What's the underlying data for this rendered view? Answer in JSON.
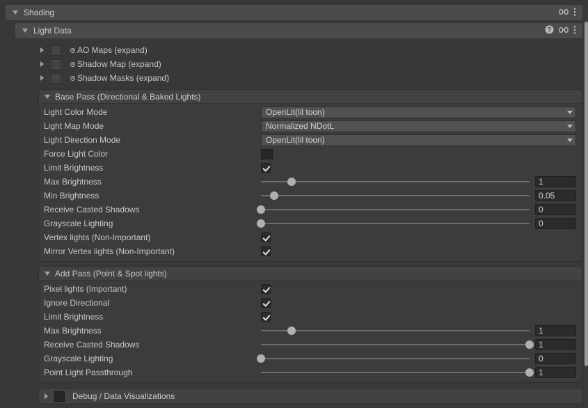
{
  "shading": {
    "title": "Shading",
    "icons": [
      "link-icon",
      "more-vertical-icon"
    ]
  },
  "light_data": {
    "title": "Light Data",
    "icons": [
      "help-icon",
      "link-icon",
      "more-vertical-icon"
    ]
  },
  "expand_rows": [
    {
      "label": "AO Maps (expand)"
    },
    {
      "label": "Shadow Map (expand)"
    },
    {
      "label": "Shadow Masks (expand)"
    }
  ],
  "base_pass": {
    "title": "Base Pass (Directional & Baked Lights)",
    "rows": [
      {
        "label": "Light Color Mode",
        "type": "dropdown",
        "value": "OpenLit(lil toon)"
      },
      {
        "label": "Light Map Mode",
        "type": "dropdown",
        "value": "Normalized NDotL"
      },
      {
        "label": "Light Direction Mode",
        "type": "dropdown",
        "value": "OpenLit(lil toon)"
      },
      {
        "label": "Force Light Color",
        "type": "color",
        "value": "#272727"
      },
      {
        "label": "Limit Brightness",
        "type": "checkbox",
        "checked": true
      },
      {
        "label": "Max Brightness",
        "type": "slider",
        "value": "1",
        "pct": 11.5
      },
      {
        "label": "Min Brightness",
        "type": "slider",
        "value": "0.05",
        "pct": 5.0
      },
      {
        "label": "Receive Casted Shadows",
        "type": "slider",
        "value": "0",
        "pct": 0
      },
      {
        "label": "Grayscale Lighting",
        "type": "slider",
        "value": "0",
        "pct": 0
      },
      {
        "label": "Vertex lights (Non-Important)",
        "type": "checkbox",
        "checked": true
      },
      {
        "label": "Mirror Vertex lights (Non-Important)",
        "type": "checkbox",
        "checked": true
      }
    ]
  },
  "add_pass": {
    "title": "Add Pass (Point & Spot lights)",
    "rows": [
      {
        "label": "Pixel lights (Important)",
        "type": "checkbox",
        "checked": true
      },
      {
        "label": "Ignore Directional",
        "type": "checkbox",
        "checked": true
      },
      {
        "label": "Limit Brightness",
        "type": "checkbox",
        "checked": true
      },
      {
        "label": "Max Brightness",
        "type": "slider",
        "value": "1",
        "pct": 11.5
      },
      {
        "label": "Receive Casted Shadows",
        "type": "slider",
        "value": "1",
        "pct": 100
      },
      {
        "label": "Grayscale Lighting",
        "type": "slider",
        "value": "0",
        "pct": 0
      },
      {
        "label": "Point Light Passthrough",
        "type": "slider",
        "value": "1",
        "pct": 100
      }
    ]
  },
  "debug": {
    "title": "Debug / Data Visualizations",
    "swatch": "#272727"
  }
}
